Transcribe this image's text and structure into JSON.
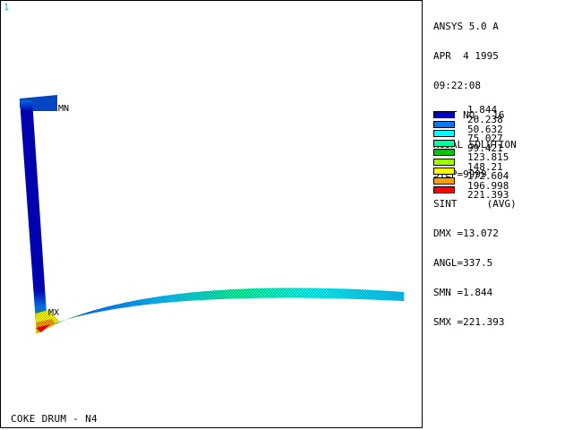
{
  "window": {
    "number": "1"
  },
  "caption": "COKE DRUM - N4",
  "header": [
    "ANSYS 5.0 A",
    "APR  4 1995",
    "09:22:08",
    "PLOT NO.  16",
    "NODAL SOLUTION",
    "STEP=9999",
    "SINT     (AVG)",
    "DMX =13.072",
    "ANGL=337.5",
    "SMN =1.844",
    "SMX =221.393"
  ],
  "plot_labels": {
    "min": "MN",
    "max": "MX"
  },
  "legend": {
    "first_value": "1.844",
    "bands": [
      {
        "color": "#0000c8",
        "value": "26.238"
      },
      {
        "color": "#0078ff",
        "value": "50.632"
      },
      {
        "color": "#00ffff",
        "value": "75.027"
      },
      {
        "color": "#00ffa0",
        "value": "99.421"
      },
      {
        "color": "#00c800",
        "value": "123.815"
      },
      {
        "color": "#a0ff00",
        "value": "148.21"
      },
      {
        "color": "#ffff00",
        "value": "172.604"
      },
      {
        "color": "#ffa000",
        "value": "196.998"
      },
      {
        "color": "#ff0000",
        "value": "221.393"
      }
    ]
  }
}
